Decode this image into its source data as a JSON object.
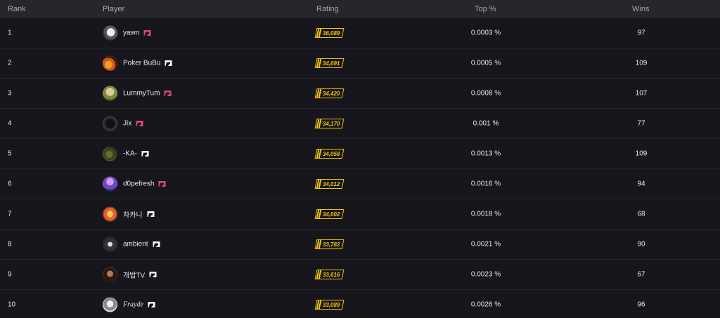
{
  "header": {
    "rank": "Rank",
    "player": "Player",
    "rating": "Rating",
    "top": "Top %",
    "wins": "Wins"
  },
  "rows": [
    {
      "rank": "1",
      "name": "yawn",
      "badge_color": "#e0457b",
      "rating": "36,089",
      "top": "0.0003 %",
      "wins": "97"
    },
    {
      "rank": "2",
      "name": "Poker BuBu",
      "badge_color": "#ffffff",
      "rating": "34,691",
      "top": "0.0005 %",
      "wins": "109"
    },
    {
      "rank": "3",
      "name": "LummyTum",
      "badge_color": "#e0457b",
      "rating": "34,420",
      "top": "0.0008 %",
      "wins": "107"
    },
    {
      "rank": "4",
      "name": "Jix",
      "badge_color": "#e0457b",
      "rating": "34,170",
      "top": "0.001 %",
      "wins": "77"
    },
    {
      "rank": "5",
      "name": "-KA-",
      "badge_color": "#ffffff",
      "rating": "34,058",
      "top": "0.0013 %",
      "wins": "109"
    },
    {
      "rank": "6",
      "name": "d0pefresh",
      "badge_color": "#e0457b",
      "rating": "34,012",
      "top": "0.0016 %",
      "wins": "94"
    },
    {
      "rank": "7",
      "name": "차카니",
      "badge_color": "#ffffff",
      "rating": "34,002",
      "top": "0.0018 %",
      "wins": "68"
    },
    {
      "rank": "8",
      "name": "ambient",
      "badge_color": "#ffffff",
      "rating": "33,782",
      "top": "0.0021 %",
      "wins": "90"
    },
    {
      "rank": "9",
      "name": "개밥TV",
      "badge_color": "#ffffff",
      "rating": "33,616",
      "top": "0.0023 %",
      "wins": "67"
    },
    {
      "rank": "10",
      "name": "Frayde",
      "badge_color": "#ffffff",
      "rating": "33,089",
      "top": "0.0026 %",
      "wins": "96"
    }
  ],
  "colors": {
    "background": "#17161d",
    "header_background": "#27262d",
    "rating_accent": "#f2c30c",
    "badge_pink": "#e0457b"
  },
  "icons": {
    "avatar": "player-avatar",
    "badge": "rank-badge-icon",
    "rating": "rating-stripes-icon"
  }
}
